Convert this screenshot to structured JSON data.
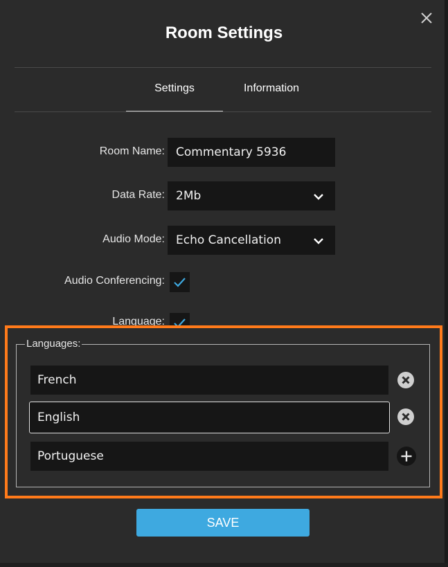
{
  "dialog": {
    "title": "Room Settings"
  },
  "tabs": [
    {
      "label": "Settings",
      "active": true
    },
    {
      "label": "Information",
      "active": false
    }
  ],
  "form": {
    "room_name": {
      "label": "Room Name:",
      "value": "Commentary 5936"
    },
    "data_rate": {
      "label": "Data Rate:",
      "value": "2Mb"
    },
    "audio_mode": {
      "label": "Audio Mode:",
      "value": "Echo Cancellation"
    },
    "audio_conferencing": {
      "label": "Audio Conferencing:",
      "checked": true
    },
    "language": {
      "label": "Language:",
      "checked": true
    }
  },
  "languages": {
    "legend": "Languages:",
    "items": [
      {
        "value": "French",
        "action": "remove-icon"
      },
      {
        "value": "English",
        "action": "remove-icon"
      },
      {
        "value": "Portuguese",
        "action": "add-icon"
      }
    ]
  },
  "actions": {
    "save_label": "SAVE"
  },
  "colors": {
    "background": "#2b2b2b",
    "field": "#161616",
    "accent": "#3ea9e0",
    "highlight": "#ff7a1a",
    "check": "#3ea9e0"
  }
}
